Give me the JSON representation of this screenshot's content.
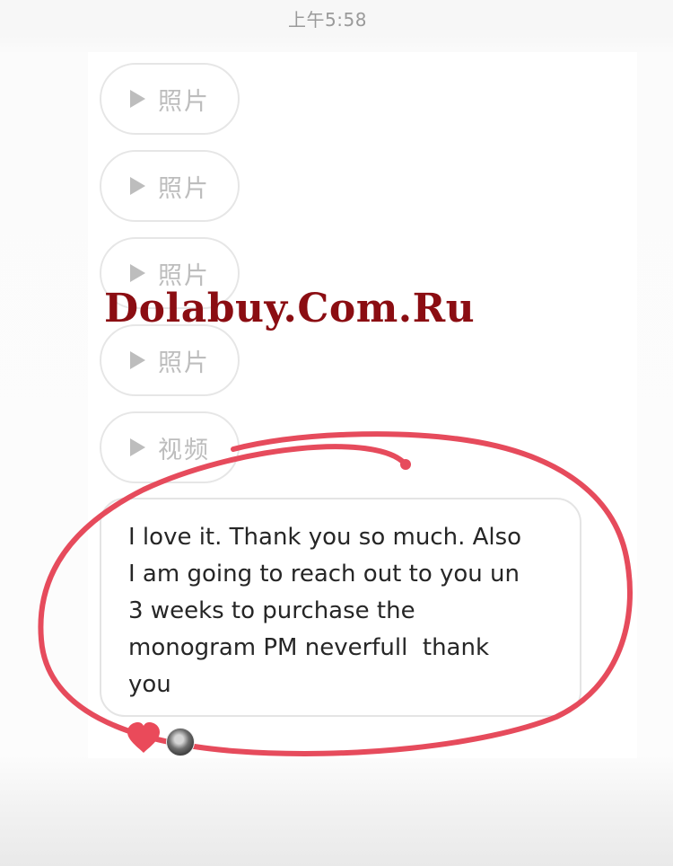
{
  "status_bar": {
    "time": "上午5:58"
  },
  "messages": {
    "media": [
      {
        "label": "照片",
        "icon": "play-icon"
      },
      {
        "label": "照片",
        "icon": "play-icon"
      },
      {
        "label": "照片",
        "icon": "play-icon"
      },
      {
        "label": "照片",
        "icon": "play-icon"
      },
      {
        "label": "视频",
        "icon": "play-icon"
      }
    ],
    "text_message": "I love it. Thank you so much. Also\nI am going to reach out to you un\n3 weeks to purchase the\nmonogram PM neverfull  thank\nyou",
    "reaction": "heart-icon"
  },
  "watermark": {
    "text": "Dolabuy.Com.Ru",
    "color": "#8b0d12"
  },
  "annotation_color": "#e64b5c"
}
